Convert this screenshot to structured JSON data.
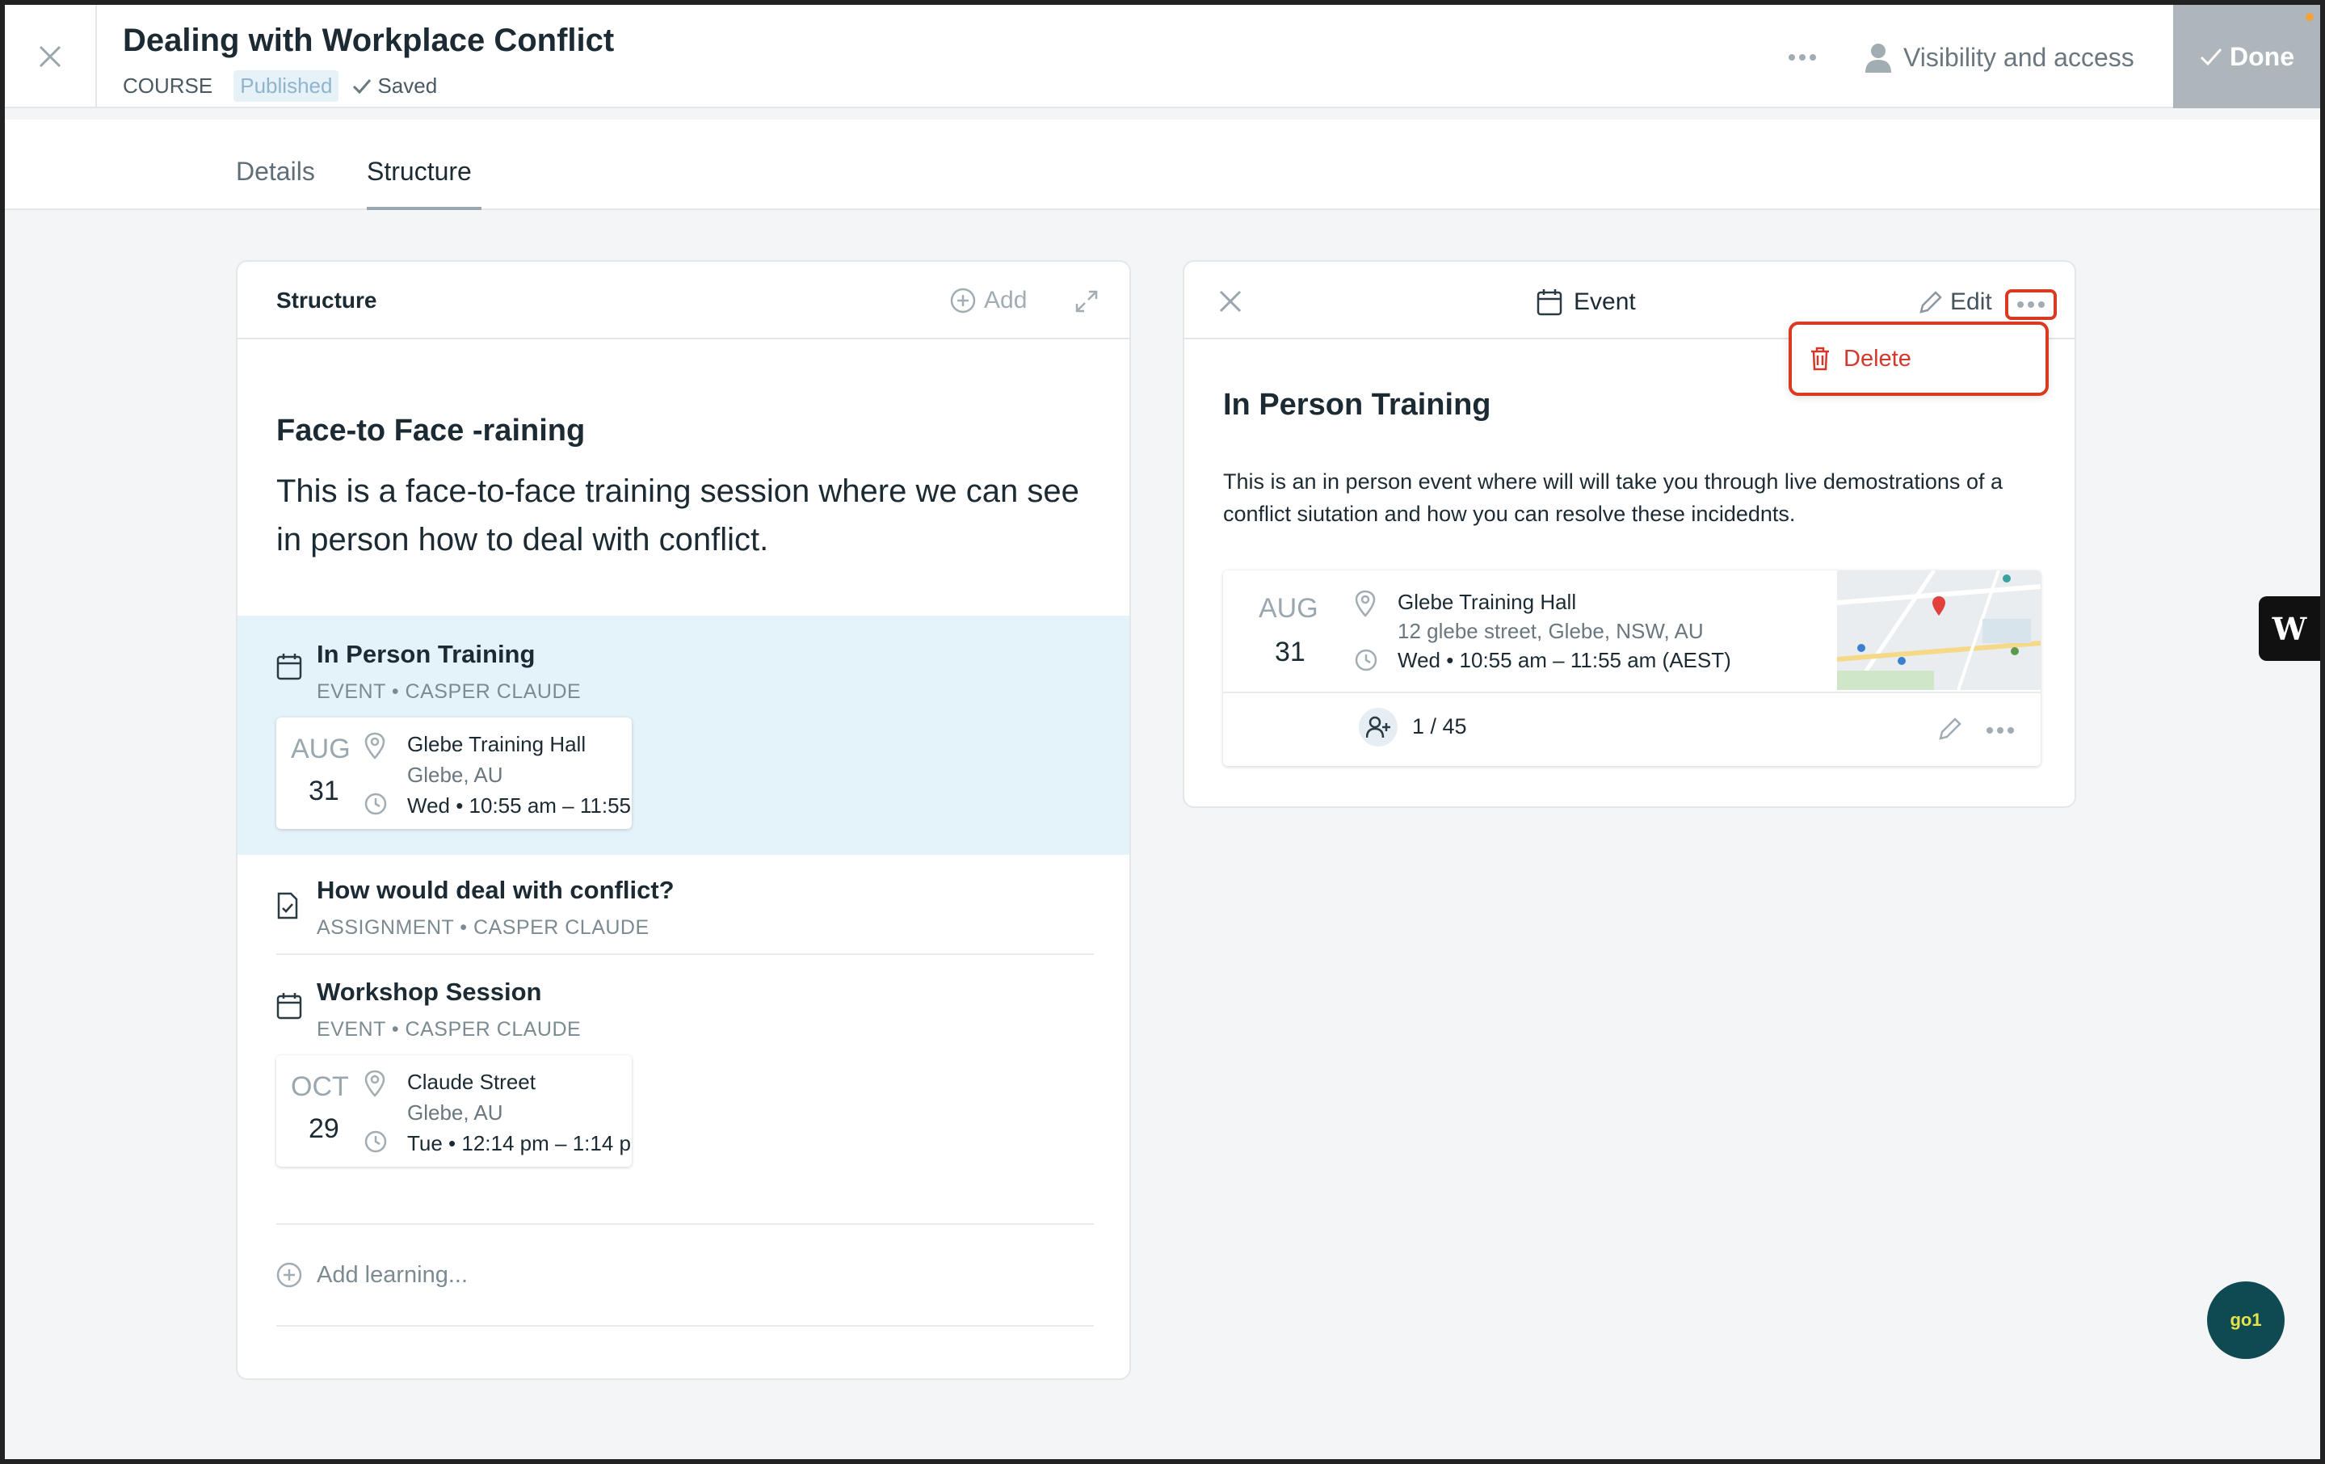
{
  "header": {
    "title": "Dealing with Workplace Conflict",
    "type": "COURSE",
    "status": "Published",
    "saved": "Saved",
    "visibility": "Visibility and access",
    "done": "Done"
  },
  "tabs": [
    {
      "label": "Details",
      "active": false
    },
    {
      "label": "Structure",
      "active": true
    }
  ],
  "structure_panel": {
    "title": "Structure",
    "add": "Add",
    "module_title": "Face-to Face -raining",
    "module_desc": "This is a face-to-face training session where we can see in person how to deal with conflict.",
    "items": [
      {
        "title": "In Person Training",
        "sub": "EVENT • CASPER CLAUDE",
        "icon": "calendar-icon",
        "card": {
          "month": "AUG",
          "day": "31",
          "venue": "Glebe Training Hall",
          "place": "Glebe, AU",
          "time": "Wed • 10:55 am – 11:55"
        }
      },
      {
        "title": "How would deal with conflict?",
        "sub": "ASSIGNMENT • CASPER CLAUDE",
        "icon": "assignment-icon"
      },
      {
        "title": "Workshop Session",
        "sub": "EVENT • CASPER CLAUDE",
        "icon": "calendar-icon",
        "card": {
          "month": "OCT",
          "day": "29",
          "venue": "Claude Street",
          "place": "Glebe, AU",
          "time": "Tue • 12:14 pm – 1:14 p"
        }
      }
    ],
    "add_learning": "Add learning..."
  },
  "event_panel": {
    "label": "Event",
    "edit": "Edit",
    "menu": {
      "delete": "Delete"
    },
    "title": "In Person Training",
    "desc": "This is an in person event where will will take you through live demostrations of a conflict siutation and how you can resolve these incidednts.",
    "card": {
      "month": "AUG",
      "day": "31",
      "venue": "Glebe Training Hall",
      "address": "12 glebe street, Glebe, NSW, AU",
      "time": "Wed • 10:55 am – 11:55 am (AEST)",
      "attendance": "1 / 45"
    }
  },
  "floating": {
    "w": "W",
    "go1": "go1"
  },
  "colors": {
    "accent_red": "#d93a21",
    "selected_row": "#e4f2f9",
    "done_button": "#aeb6bb"
  }
}
